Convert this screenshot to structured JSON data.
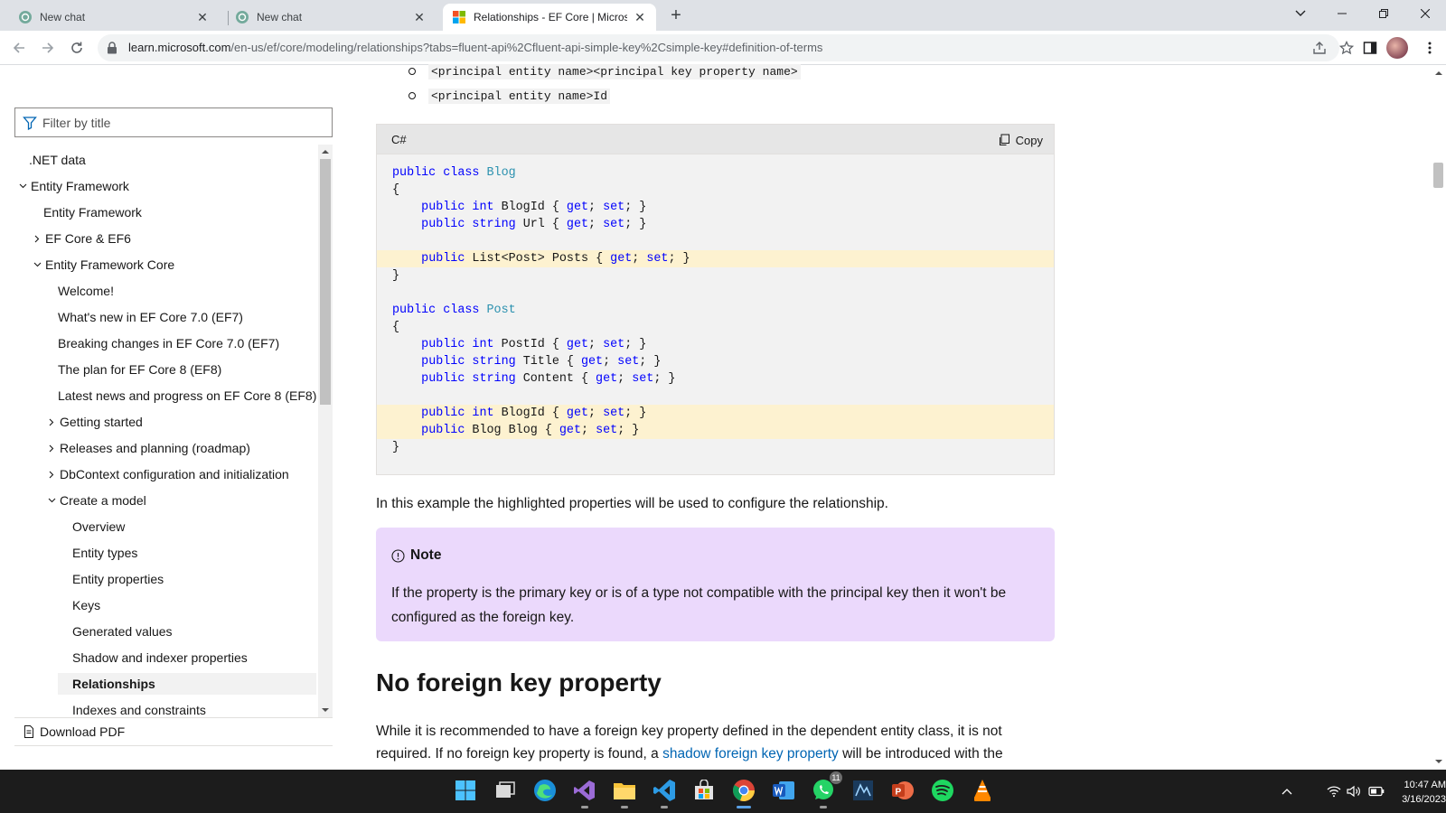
{
  "browser": {
    "tabs": [
      {
        "title": "New chat"
      },
      {
        "title": "New chat"
      },
      {
        "title": "Relationships - EF Core | Microso"
      }
    ],
    "url": {
      "host": "learn.microsoft.com",
      "path": "/en-us/ef/core/modeling/relationships?tabs=fluent-api%2Cfluent-api-simple-key%2Csimple-key#definition-of-terms"
    }
  },
  "sidebar": {
    "filter_placeholder": "Filter by title",
    "items": [
      {
        "label": ".NET data"
      },
      {
        "label": "Entity Framework"
      },
      {
        "label": "Entity Framework"
      },
      {
        "label": "EF Core & EF6"
      },
      {
        "label": "Entity Framework Core"
      },
      {
        "label": "Welcome!"
      },
      {
        "label": "What's new in EF Core 7.0 (EF7)"
      },
      {
        "label": "Breaking changes in EF Core 7.0 (EF7)"
      },
      {
        "label": "The plan for EF Core 8 (EF8)"
      },
      {
        "label": "Latest news and progress on EF Core 8 (EF8)"
      },
      {
        "label": "Getting started"
      },
      {
        "label": "Releases and planning (roadmap)"
      },
      {
        "label": "DbContext configuration and initialization"
      },
      {
        "label": "Create a model"
      },
      {
        "label": "Overview"
      },
      {
        "label": "Entity types"
      },
      {
        "label": "Entity properties"
      },
      {
        "label": "Keys"
      },
      {
        "label": "Generated values"
      },
      {
        "label": "Shadow and indexer properties"
      },
      {
        "label": "Relationships"
      },
      {
        "label": "Indexes and constraints"
      }
    ],
    "download_label": "Download PDF"
  },
  "content": {
    "bullets": [
      "<principal entity name><principal key property name>",
      "<principal entity name>Id"
    ],
    "code": {
      "language": "C#",
      "copy_label": "Copy",
      "lines": [
        "public class Blog",
        "{",
        "    public int BlogId { get; set; }",
        "    public string Url { get; set; }",
        "",
        "    public List<Post> Posts { get; set; }",
        "}",
        "",
        "public class Post",
        "{",
        "    public int PostId { get; set; }",
        "    public string Title { get; set; }",
        "    public string Content { get; set; }",
        "",
        "    public int BlogId { get; set; }",
        "    public Blog Blog { get; set; }",
        "}"
      ]
    },
    "intro_paragraph": "In this example the highlighted properties will be used to configure the relationship.",
    "note": {
      "title": "Note",
      "body": "If the property is the primary key or is of a type not compatible with the principal key then it won't be configured as the foreign key."
    },
    "heading": "No foreign key property",
    "paragraph": {
      "line1": "While it is recommended to have a foreign key property defined in the dependent entity class, it is not",
      "line2_before": "required. If no foreign key property is found, a ",
      "line2_link": "shadow foreign key property",
      "line2_after": " will be introduced with the"
    }
  },
  "taskbar": {
    "apps": [
      "start-icon",
      "task-view-icon",
      "edge-icon",
      "visual-studio-icon",
      "file-explorer-icon",
      "vscode-icon",
      "store-icon",
      "chrome-icon",
      "word-icon",
      "whatsapp-icon",
      "rider-icon",
      "powerpoint-icon",
      "spotify-icon",
      "vlc-icon"
    ],
    "whatsapp_badge": "11",
    "time": "10:47 AM",
    "date": "3/16/2023"
  },
  "colors": {
    "accent_link": "#0065b3",
    "note_bg": "#ebd9fc",
    "code_highlight": "#fdf2d0",
    "keyword": "#0101fd",
    "type": "#2b91af"
  }
}
